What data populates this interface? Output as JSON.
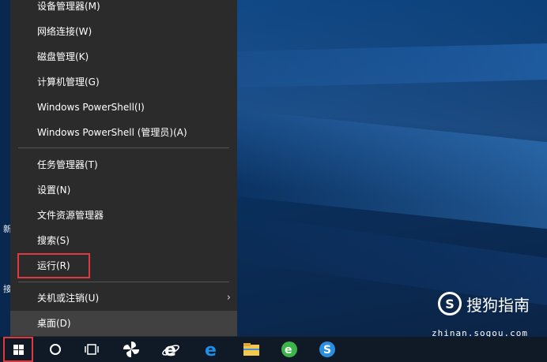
{
  "menu": {
    "items": [
      {
        "label": "设备管理器(M)"
      },
      {
        "label": "网络连接(W)"
      },
      {
        "label": "磁盘管理(K)"
      },
      {
        "label": "计算机管理(G)"
      },
      {
        "label": "Windows PowerShell(I)"
      },
      {
        "label": "Windows PowerShell (管理员)(A)"
      },
      {
        "label": "任务管理器(T)"
      },
      {
        "label": "设置(N)"
      },
      {
        "label": "文件资源管理器"
      },
      {
        "label": "搜索(S)"
      },
      {
        "label": "运行(R)"
      },
      {
        "label": "关机或注销(U)"
      },
      {
        "label": "桌面(D)"
      }
    ],
    "submenu_glyph": "›"
  },
  "desktop_edge": {
    "char1": "新",
    "char2": "接"
  },
  "taskbar": {
    "icons": [
      "windows-start-icon",
      "cortana-search-icon",
      "task-view-icon",
      "pinwheel-app-icon",
      "internet-explorer-icon",
      "edge-icon",
      "file-explorer-icon",
      "green-browser-icon",
      "sogou-browser-icon"
    ]
  },
  "watermark": {
    "logo_letter": "S",
    "brand": "搜狗指南",
    "url": "zhinan.sogou.com"
  },
  "colors": {
    "menu_bg": "#2b2b2b",
    "highlight": "#e0383f",
    "taskbar_bg": "#0f1a26"
  }
}
